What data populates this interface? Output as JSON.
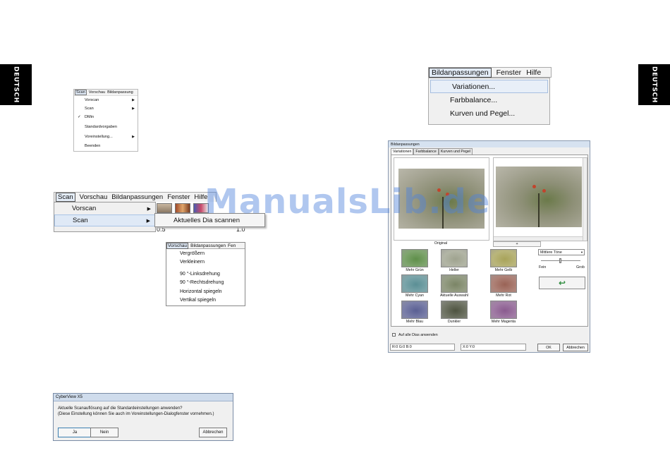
{
  "side_tab_label": "DEUTSCH",
  "scan_menu_small": {
    "bar": [
      "Scan",
      "Vorschau",
      "Bildanpassung"
    ],
    "items": [
      {
        "label": "Vorscan",
        "arrow": true,
        "check": false
      },
      {
        "label": "Scan",
        "arrow": true,
        "check": false
      },
      {
        "label": "DMin",
        "arrow": false,
        "check": true
      },
      {
        "label": "Standardvorgaben",
        "arrow": false,
        "check": false
      },
      {
        "label": "Voreinstellung...",
        "arrow": true,
        "check": false
      },
      {
        "label": "Beenden",
        "arrow": false,
        "check": false
      }
    ]
  },
  "scan_menu_large": {
    "bar": [
      "Scan",
      "Vorschau",
      "Bildanpassungen",
      "Fenster",
      "Hilfe"
    ],
    "items": [
      "Vorscan",
      "Scan"
    ],
    "submenu_item": "Aktuelles Dia scannen",
    "numbers": [
      "0.5",
      "1.0"
    ]
  },
  "vorschau_menu": {
    "bar": [
      "Vorschau",
      "Bildanpassungen",
      "Fen"
    ],
    "items": [
      "Vergrößern",
      "Verkleinern",
      "90 °-Linksdrehung",
      "90 °-Rechtsdrehung",
      "Horizontal spiegeln",
      "Vertikal spiegeln"
    ]
  },
  "confirm_dialog": {
    "title": "CyberView X5",
    "line1": "Aktuelle Scanauflösung auf die Standardeinstellungen anwenden?",
    "line2": "(Diese Einstellung können Sie auch im Voreinstellungen-Dialogfenster vornehmen.)",
    "yes": "Ja",
    "no": "Nein",
    "cancel": "Abbrechen"
  },
  "adjust_menu": {
    "bar": [
      "Bildanpassungen",
      "Fenster",
      "Hilfe"
    ],
    "items": [
      "Variationen...",
      "Farbbalance...",
      "Kurven und Pegel..."
    ]
  },
  "adjust_dialog": {
    "title": "Bildanpassungen",
    "tabs": [
      "Variationen",
      "Farbbalance",
      "Kurven und Pegel"
    ],
    "original_label": "Original",
    "plus_label": "+",
    "tone_select": "Mittlere Töne",
    "fine_label": "Fein",
    "coarse_label": "Grob",
    "variations": [
      "Mehr Grün",
      "Heller",
      "Mehr Gelb",
      "Mehr Cyan",
      "Aktuelle Auswahl",
      "Mehr Rot",
      "Mehr Blau",
      "Dunkler",
      "Mehr Magenta"
    ],
    "variation_colors": [
      "#5f8f4a",
      "#9fa38f",
      "#a8a35a",
      "#5b8f95",
      "#7b8566",
      "#9a6356",
      "#5a5f93",
      "#4e5340",
      "#8a5b8f"
    ],
    "apply_all": "Auf alle Dias anwenden",
    "rgb_readout": "R:0 G:0 B:0",
    "xy_readout": "X:0 Y:0",
    "ok": "OK",
    "cancel": "Abbrechen"
  },
  "watermark": "ManualsLib.de"
}
